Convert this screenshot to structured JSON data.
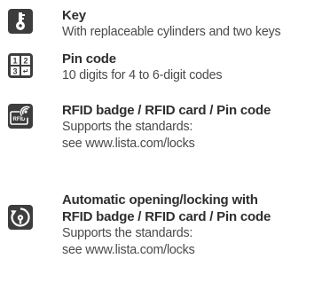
{
  "colors": {
    "icon_background": "#3d3d3d",
    "icon_foreground": "#ffffff",
    "title_text": "#2e2e2e",
    "body_text": "#4a4a4a"
  },
  "items": [
    {
      "icon": "key-icon",
      "title": "Key",
      "lines": [
        "With replaceable cylinders and two keys"
      ]
    },
    {
      "icon": "keypad-icon",
      "title": "Pin code",
      "lines": [
        "10 digits for 4 to 6-digit codes"
      ],
      "keypad_keys": [
        "1",
        "2",
        "3",
        "↵"
      ]
    },
    {
      "icon": "rfid-icon",
      "title": "RFID badge / RFID card / Pin code",
      "lines": [
        "Supports the standards:",
        "see www.lista.com/locks"
      ],
      "icon_label": "RFID"
    },
    {
      "icon": "auto-lock-icon",
      "title": "Automatic opening/locking with",
      "title2": "RFID badge / RFID card / Pin code",
      "lines": [
        "Supports the standards:",
        "see www.lista.com/locks"
      ]
    }
  ]
}
